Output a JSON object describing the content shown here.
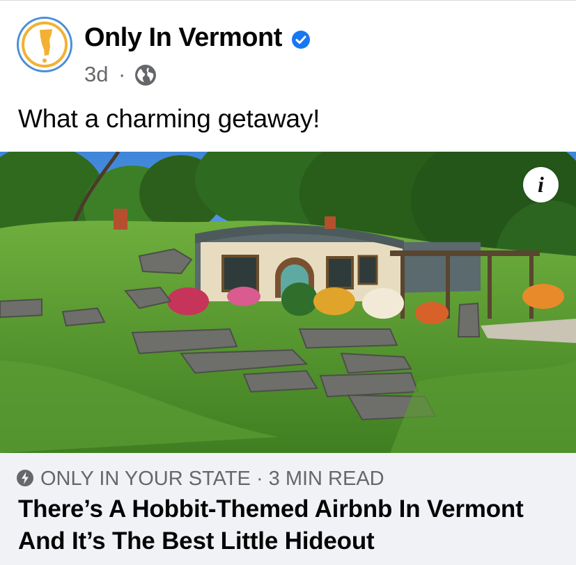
{
  "post": {
    "page_name": "Only In Vermont",
    "time": "3d",
    "separator": "·",
    "audience_icon": "globe-icon",
    "verified_icon": "verified-badge-icon",
    "text": "What a charming getaway!"
  },
  "photo": {
    "alt_icon": "info-icon",
    "info_glyph": "i"
  },
  "link": {
    "source_icon": "lightning-bolt-icon",
    "source": "ONLY IN YOUR STATE · 3 MIN READ",
    "headline": "There’s A Hobbit-Themed Airbnb In Vermont And It’s The Best Little Hideout"
  },
  "colors": {
    "brand_blue": "#4a90d9",
    "verified_blue": "#1877f2",
    "secondary_text": "#65676b",
    "card_bg": "#f0f2f5"
  }
}
